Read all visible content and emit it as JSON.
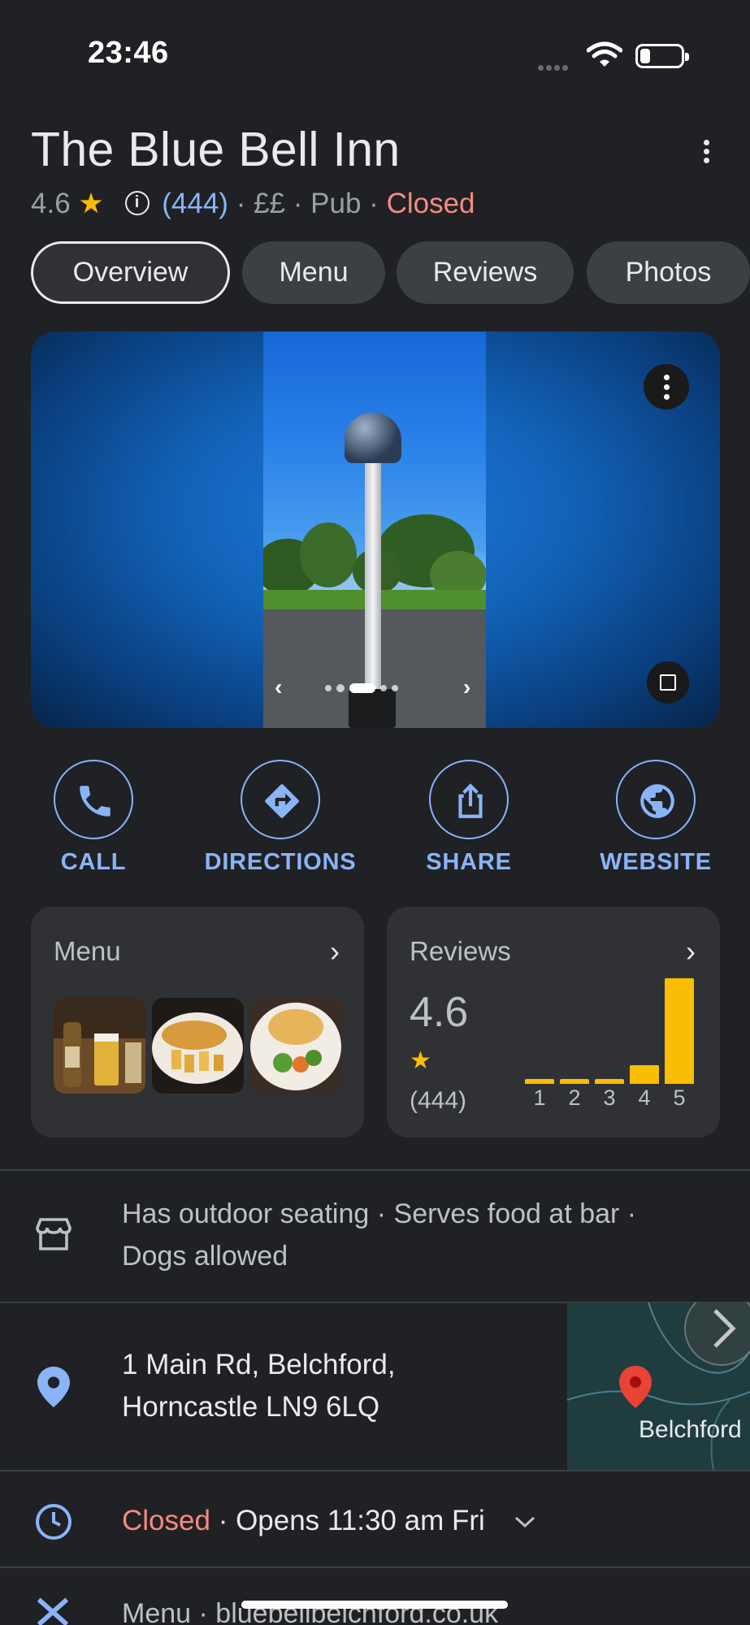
{
  "status_bar": {
    "time": "23:46"
  },
  "header": {
    "title": "The Blue Bell Inn",
    "rating": "4.6",
    "rating_star": "★",
    "review_count": "(444)",
    "price": "££",
    "category": "Pub",
    "open_status": "Closed",
    "separator": "·"
  },
  "tabs": [
    {
      "label": "Overview",
      "active": true
    },
    {
      "label": "Menu",
      "active": false
    },
    {
      "label": "Reviews",
      "active": false
    },
    {
      "label": "Photos",
      "active": false
    }
  ],
  "carousel": {
    "page_count": 5,
    "active_page": 3
  },
  "actions": [
    {
      "label": "CALL",
      "icon": "phone-icon"
    },
    {
      "label": "DIRECTIONS",
      "icon": "directions-icon"
    },
    {
      "label": "SHARE",
      "icon": "share-icon"
    },
    {
      "label": "WEBSITE",
      "icon": "globe-icon"
    }
  ],
  "menu_card": {
    "title": "Menu",
    "chevron": "›"
  },
  "reviews_card": {
    "title": "Reviews",
    "chevron": "›",
    "rating": "4.6",
    "star": "★",
    "count": "(444)",
    "distribution": [
      {
        "star": "1",
        "fraction": 0.02
      },
      {
        "star": "2",
        "fraction": 0.02
      },
      {
        "star": "3",
        "fraction": 0.03
      },
      {
        "star": "4",
        "fraction": 0.14
      },
      {
        "star": "5",
        "fraction": 0.78
      }
    ]
  },
  "amenities": {
    "line1": "Has outdoor seating · Serves food at bar ·",
    "line2": "Dogs allowed"
  },
  "address": {
    "line1": "1 Main Rd, Belchford,",
    "line2": "Horncastle LN9 6LQ",
    "map_label": "Belchford"
  },
  "hours": {
    "status": "Closed",
    "detail": "· Opens 11:30 am Fri"
  },
  "menu_link": {
    "label": "Menu",
    "url": "bluebellbelchford.co.uk"
  },
  "colors": {
    "accent": "#8ab4f8",
    "star": "#fbbc04",
    "closed": "#f28b82",
    "background": "#202124"
  }
}
